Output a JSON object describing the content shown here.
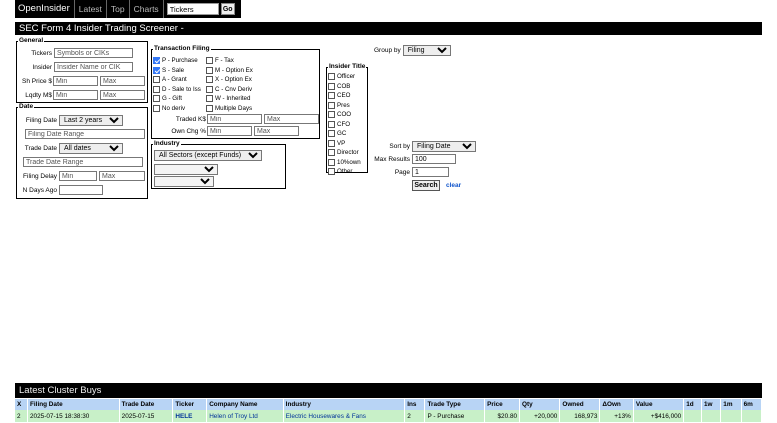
{
  "topnav": {
    "brand": "OpenInsider",
    "links": [
      "Latest",
      "Top",
      "Charts"
    ],
    "search_value": "Tickers",
    "go_label": "Go"
  },
  "header": {
    "title": "SEC Form 4 Insider Trading Screener -"
  },
  "general": {
    "legend": "General",
    "tickers_label": "Tickers",
    "tickers_placeholder": "Symbols or CIKs",
    "insider_label": "Insider",
    "insider_placeholder": "Insider Name or CIK",
    "price_label": "Sh Price $",
    "liquidity_label": "Lqdty M$",
    "min_placeholder": "Min",
    "max_placeholder": "Max"
  },
  "date": {
    "legend": "Date",
    "filing_label": "Filing Date",
    "filing_select": "Last 2 years",
    "filing_range_placeholder": "Filing Date Range",
    "trade_label": "Trade Date",
    "trade_select": "All dates",
    "trade_range_placeholder": "Trade Date Range",
    "delay_label": "Filing Delay",
    "ndays_label": "N Days Ago"
  },
  "transaction": {
    "legend": "Transaction Filing",
    "col1": [
      {
        "label": "P - Purchase",
        "checked": true
      },
      {
        "label": "S - Sale",
        "checked": true
      },
      {
        "label": "A - Grant",
        "checked": false
      },
      {
        "label": "D - Sale to Iss",
        "checked": false
      },
      {
        "label": "G - Gift",
        "checked": false
      },
      {
        "label": "No deriv",
        "checked": false
      }
    ],
    "col2": [
      {
        "label": "F - Tax",
        "checked": false
      },
      {
        "label": "M - Option Ex",
        "checked": false
      },
      {
        "label": "X - Option Ex",
        "checked": false
      },
      {
        "label": "C - Cnv Deriv",
        "checked": false
      },
      {
        "label": "W - Inherited",
        "checked": false
      },
      {
        "label": "Multiple Days",
        "checked": false
      }
    ],
    "traded_label": "Traded K$",
    "ownchg_label": "Own Chg %"
  },
  "industry": {
    "legend": "Industry",
    "sector_select": "All Sectors (except Funds)"
  },
  "insider_title": {
    "legend": "Insider Title",
    "items": [
      "Officer",
      "COB",
      "CEO",
      "Pres",
      "COO",
      "CFO",
      "GC",
      "VP",
      "Director",
      "10%own",
      "Other"
    ]
  },
  "options": {
    "groupby_label": "Group by",
    "groupby_value": "Filing",
    "sortby_label": "Sort by",
    "sortby_value": "Filing Date",
    "maxresults_label": "Max Results",
    "maxresults_value": "100",
    "page_label": "Page",
    "page_value": "1",
    "search_label": "Search",
    "clear_label": "clear"
  },
  "cluster": {
    "title": "Latest Cluster Buys",
    "columns": [
      "X",
      "Filing Date",
      "Trade Date",
      "Ticker",
      "Company Name",
      "Industry",
      "Ins",
      "Trade Type",
      "Price",
      "Qty",
      "Owned",
      "ΔOwn",
      "Value",
      "1d",
      "1w",
      "1m",
      "6m"
    ],
    "rows": [
      {
        "x": "2",
        "filing_date": "2025-07-15 18:38:30",
        "trade_date": "2025-07-15",
        "ticker": "HELE",
        "company": "Helen of Troy Ltd",
        "industry": "Electric Housewares & Fans",
        "ins": "2",
        "trade_type": "P - Purchase",
        "price": "$20.80",
        "qty": "+20,000",
        "owned": "168,973",
        "down": "+13%",
        "value": "+$416,000",
        "d1": "",
        "w1": "",
        "m1": "",
        "m6": ""
      }
    ]
  },
  "colors": {
    "bar": "#000000",
    "table_header": "#b8d4f5",
    "row_green": "#c8f0c8",
    "link": "#003399"
  }
}
